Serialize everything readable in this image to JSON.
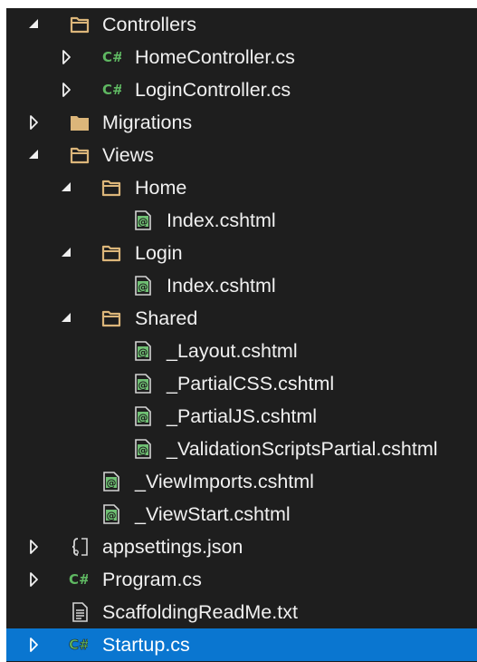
{
  "tree": {
    "rows": [
      {
        "label": "Controllers",
        "icon": "folder-open",
        "expander": "expanded",
        "depth": 1
      },
      {
        "label": "HomeController.cs",
        "icon": "csharp-file",
        "expander": "collapsed",
        "depth": 2
      },
      {
        "label": "LoginController.cs",
        "icon": "csharp-file",
        "expander": "collapsed",
        "depth": 2
      },
      {
        "label": "Migrations",
        "icon": "folder-closed",
        "expander": "collapsed",
        "depth": 1
      },
      {
        "label": "Views",
        "icon": "folder-open",
        "expander": "expanded",
        "depth": 1
      },
      {
        "label": "Home",
        "icon": "folder-open",
        "expander": "expanded",
        "depth": 2
      },
      {
        "label": "Index.cshtml",
        "icon": "razor-file",
        "expander": "none",
        "depth": 3
      },
      {
        "label": "Login",
        "icon": "folder-open",
        "expander": "expanded",
        "depth": 2
      },
      {
        "label": "Index.cshtml",
        "icon": "razor-file",
        "expander": "none",
        "depth": 3
      },
      {
        "label": "Shared",
        "icon": "folder-open",
        "expander": "expanded",
        "depth": 2
      },
      {
        "label": "_Layout.cshtml",
        "icon": "razor-file",
        "expander": "none",
        "depth": 3
      },
      {
        "label": "_PartialCSS.cshtml",
        "icon": "razor-file",
        "expander": "none",
        "depth": 3
      },
      {
        "label": "_PartialJS.cshtml",
        "icon": "razor-file",
        "expander": "none",
        "depth": 3
      },
      {
        "label": "_ValidationScriptsPartial.cshtml",
        "icon": "razor-file",
        "expander": "none",
        "depth": 3
      },
      {
        "label": "_ViewImports.cshtml",
        "icon": "razor-file",
        "expander": "none",
        "depth": 2
      },
      {
        "label": "_ViewStart.cshtml",
        "icon": "razor-file",
        "expander": "none",
        "depth": 2
      },
      {
        "label": "appsettings.json",
        "icon": "json-file",
        "expander": "collapsed",
        "depth": 1
      },
      {
        "label": "Program.cs",
        "icon": "csharp-file",
        "expander": "collapsed",
        "depth": 1
      },
      {
        "label": "ScaffoldingReadMe.txt",
        "icon": "text-file",
        "expander": "none",
        "depth": 1
      },
      {
        "label": "Startup.cs",
        "icon": "csharp-file",
        "expander": "collapsed",
        "depth": 1,
        "selected": true
      }
    ]
  },
  "icon_glyphs": {
    "csharp": "C#",
    "razor": "@"
  },
  "colors": {
    "panel_background": "#1e1e1e",
    "selection": "#0a76d0",
    "text": "#f0f0f0",
    "folder": "#dcb67a",
    "csharp_green": "#5fb862",
    "razor_green": "#6fbf73"
  }
}
